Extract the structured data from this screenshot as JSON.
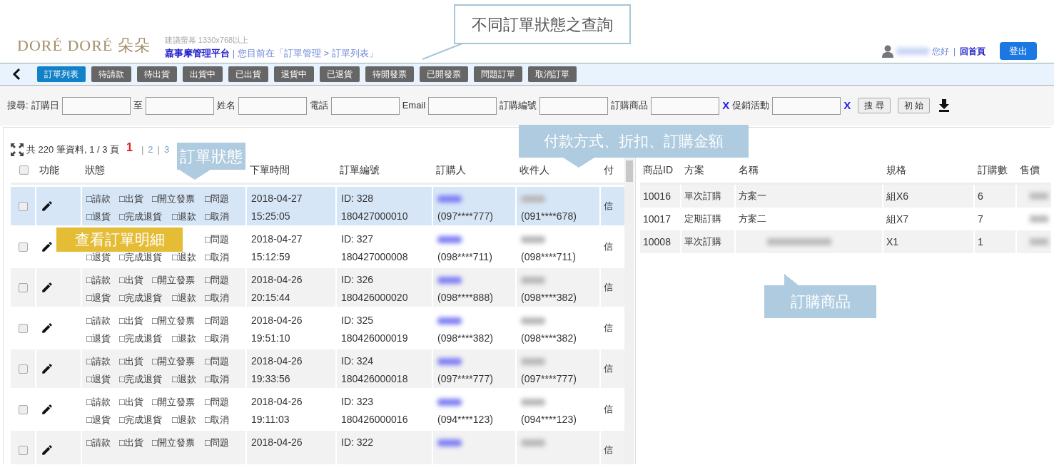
{
  "header": {
    "logo": "DORÉ DORÉ 朵朵",
    "screen_hint": "建議螢幕 1330x768以上",
    "platform": "嘉事摩管理平台",
    "breadcrumb": "| 您目前在「訂單管理 > 訂單列表」",
    "greeting": "您好",
    "separator": "|",
    "home_link": "回首頁",
    "logout": "登出"
  },
  "tabs": [
    {
      "label": "訂單列表",
      "selected": true
    },
    {
      "label": "待請款",
      "selected": false
    },
    {
      "label": "待出貨",
      "selected": false
    },
    {
      "label": "出貨中",
      "selected": false
    },
    {
      "label": "已出貨",
      "selected": false
    },
    {
      "label": "退貨中",
      "selected": false
    },
    {
      "label": "已退貨",
      "selected": false
    },
    {
      "label": "待開發票",
      "selected": false
    },
    {
      "label": "已開發票",
      "selected": false
    },
    {
      "label": "問題訂單",
      "selected": false
    },
    {
      "label": "取消訂單",
      "selected": false
    }
  ],
  "search": {
    "label": "搜尋:",
    "fields": [
      {
        "label": "訂購日",
        "clear": false
      },
      {
        "label": "至",
        "clear": false
      },
      {
        "label": "姓名",
        "clear": false
      },
      {
        "label": "電話",
        "clear": false
      },
      {
        "label": "Email",
        "clear": false
      },
      {
        "label": "訂購編號",
        "clear": false
      },
      {
        "label": "訂購商品",
        "clear": true,
        "clear_label": "X"
      },
      {
        "label": "促銷活動",
        "clear": true,
        "clear_label": "X"
      }
    ],
    "buttons": [
      "搜 尋",
      "初 始"
    ]
  },
  "orders": {
    "summary": "共 220 筆資料, 1 / 3 頁",
    "pages": [
      {
        "label": "1",
        "selected": true
      },
      {
        "label": "2",
        "selected": false
      },
      {
        "label": "3",
        "selected": false
      }
    ],
    "page_separator": "|",
    "select_all_checked": false,
    "columns": [
      "功能",
      "狀態",
      "下單時間",
      "訂單編號",
      "訂購人",
      "收件人",
      "付"
    ],
    "rows": [
      {
        "selected": true,
        "checked": false,
        "status": [
          [
            "□請款",
            "□出貨",
            "□開立發票",
            "□問題"
          ],
          [
            "□退貨",
            "□完成退貨",
            "□退款",
            "□取消"
          ]
        ],
        "time": [
          "2018-04-27",
          "15:25:05"
        ],
        "order": [
          "ID: 328",
          "180427000010"
        ],
        "buyer_phone": "(097****777)",
        "receiver_phone": "(091****678)",
        "payment": "信"
      },
      {
        "selected": false,
        "checked": false,
        "status": [
          [
            "□問題"
          ],
          [
            "□退貨",
            "□完成退貨",
            "□退款",
            "□取消"
          ]
        ],
        "time": [
          "2018-04-27",
          "15:12:59"
        ],
        "order": [
          "ID: 327",
          "180427000008"
        ],
        "buyer_phone": "(098****711)",
        "receiver_phone": "(098****711)",
        "payment": "信"
      },
      {
        "selected": false,
        "checked": false,
        "status": [
          [
            "□請款",
            "□出貨",
            "□開立發票",
            "□問題"
          ],
          [
            "□退貨",
            "□完成退貨",
            "□退款",
            "□取消"
          ]
        ],
        "time": [
          "2018-04-26",
          "20:15:44"
        ],
        "order": [
          "ID: 326",
          "180426000020"
        ],
        "buyer_phone": "(098****888)",
        "receiver_phone": "(098****382)",
        "payment": "信"
      },
      {
        "selected": false,
        "checked": false,
        "status": [
          [
            "□請款",
            "□出貨",
            "□開立發票",
            "□問題"
          ],
          [
            "□退貨",
            "□完成退貨",
            "□退款",
            "□取消"
          ]
        ],
        "time": [
          "2018-04-26",
          "19:51:10"
        ],
        "order": [
          "ID: 325",
          "180426000019"
        ],
        "buyer_phone": "(098****382)",
        "receiver_phone": "(098****382)",
        "payment": "信"
      },
      {
        "selected": false,
        "checked": false,
        "status": [
          [
            "□請款",
            "□出貨",
            "□開立發票",
            "□問題"
          ],
          [
            "□退貨",
            "□完成退貨",
            "□退款",
            "□取消"
          ]
        ],
        "time": [
          "2018-04-26",
          "19:33:56"
        ],
        "order": [
          "ID: 324",
          "180426000018"
        ],
        "buyer_phone": "(097****777)",
        "receiver_phone": "(097****777)",
        "payment": "信"
      },
      {
        "selected": false,
        "checked": false,
        "status": [
          [
            "□請款",
            "□出貨",
            "□開立發票",
            "□問題"
          ],
          [
            "□退貨",
            "□完成退貨",
            "□退款",
            "□取消"
          ]
        ],
        "time": [
          "2018-04-26",
          "19:11:03"
        ],
        "order": [
          "ID: 323",
          "180426000016"
        ],
        "buyer_phone": "(094****123)",
        "receiver_phone": "(094****123)",
        "payment": "信"
      },
      {
        "selected": false,
        "checked": false,
        "status": [
          [
            "□請款",
            "□出貨",
            "□開立發票",
            "□問題"
          ]
        ],
        "time": [
          "2018-04-26"
        ],
        "order": [
          "ID: 322"
        ],
        "payment": "信"
      }
    ]
  },
  "products": {
    "columns": [
      "商品ID",
      "方案",
      "名稱",
      "規格",
      "訂購數",
      "售價"
    ],
    "rows": [
      {
        "id": "10016",
        "plan": "單次訂購",
        "name": "方案一",
        "spec": "組X6",
        "qty": "6"
      },
      {
        "id": "10017",
        "plan": "定期訂購",
        "name": "方案二",
        "spec": "組X7",
        "qty": "7"
      },
      {
        "id": "10008",
        "plan": "單次訂購",
        "spec": "X1",
        "qty": "1"
      }
    ]
  },
  "annotations": [
    {
      "kind": "box",
      "text": "不同訂單狀態之查詢"
    },
    {
      "kind": "down",
      "text": "訂單狀態"
    },
    {
      "kind": "down",
      "text": "付款方式、折扣、訂購金額"
    },
    {
      "kind": "left",
      "text": "查看訂單明細"
    },
    {
      "kind": "up",
      "text": "訂購商品"
    }
  ]
}
